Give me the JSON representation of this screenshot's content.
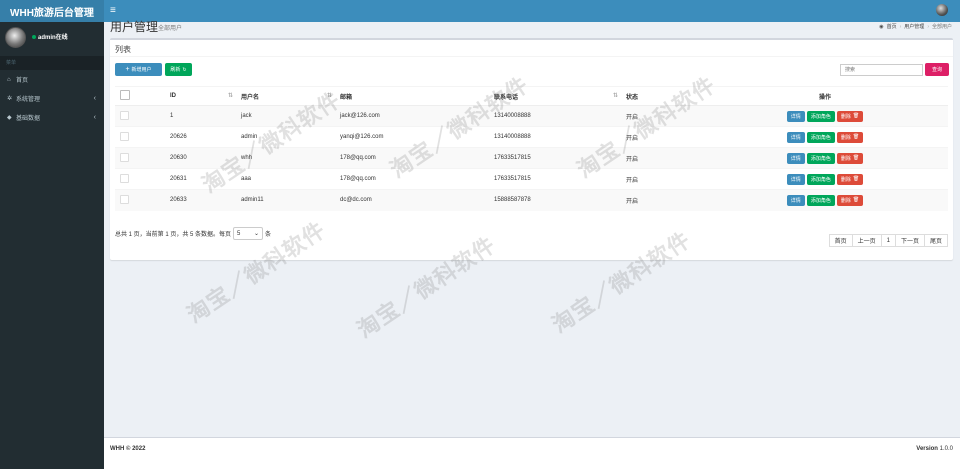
{
  "app": {
    "title": "WHH旅游后台管理"
  },
  "navbar": {
    "toggle_icon": "≡"
  },
  "sidebar": {
    "user_status": "admin在线",
    "header": "菜单",
    "items": [
      {
        "label": "首页",
        "icon": "home-icon"
      },
      {
        "label": "系统管理",
        "icon": "gears-icon"
      },
      {
        "label": "基础数据",
        "icon": "database-icon"
      }
    ]
  },
  "content_header": {
    "title": "用户管理",
    "subtitle": "全部用户",
    "breadcrumb": [
      "首页",
      "用户管理",
      "全部用户"
    ]
  },
  "box": {
    "title": "列表",
    "add_button": "新增用户",
    "refresh_button": "刷新",
    "search_placeholder": "搜索",
    "query_button": "查询"
  },
  "table": {
    "headers": [
      "ID",
      "用户名",
      "邮箱",
      "联系电话",
      "状态",
      "操作"
    ],
    "rows": [
      {
        "id": "1",
        "username": "jack",
        "email": "jack@126.com",
        "phone": "13140008888",
        "status": "开启"
      },
      {
        "id": "20626",
        "username": "admin",
        "email": "yanqi@126.com",
        "phone": "13140008888",
        "status": "开启"
      },
      {
        "id": "20630",
        "username": "whh",
        "email": "178@qq.com",
        "phone": "17633517815",
        "status": "开启"
      },
      {
        "id": "20631",
        "username": "aaa",
        "email": "178@qq.com",
        "phone": "17633517815",
        "status": "开启"
      },
      {
        "id": "20633",
        "username": "admin11",
        "email": "dc@dc.com",
        "phone": "15888587878",
        "status": "开启"
      }
    ],
    "actions": {
      "detail": "详情",
      "add_role": "添加角色",
      "delete": "删除"
    }
  },
  "pager": {
    "info_prefix": "总共 1 页，当前第 1 页，共 5 条数据。每页",
    "page_size": "5",
    "info_suffix": "条",
    "buttons": [
      "首页",
      "上一页",
      "1",
      "下一页",
      "尾页"
    ]
  },
  "footer": {
    "copyright": "WHH © 2022",
    "version_label": "Version",
    "version": "1.0.0"
  },
  "watermark": "淘宝／微科软件",
  "colors": {
    "primary": "#3c8dbc",
    "success": "#00a65a",
    "danger": "#dd4b39",
    "query": "#dd1f66",
    "sidebar": "#222d32"
  }
}
